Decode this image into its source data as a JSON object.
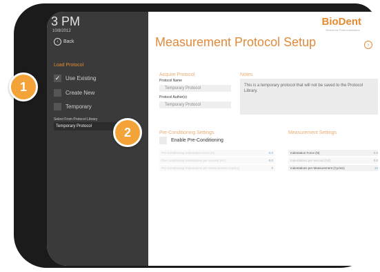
{
  "sidebar": {
    "time": "3 PM",
    "date": "10/8/2012",
    "back_label": "Back",
    "load_heading": "Load Protocol",
    "options": [
      {
        "label": "Use Existing",
        "checked": true
      },
      {
        "label": "Create New",
        "checked": false
      },
      {
        "label": "Temporary",
        "checked": false
      }
    ],
    "library_label": "Select From Protocol Library",
    "library_value": "Temporary Protocol"
  },
  "header": {
    "brand": "BioDent",
    "tagline": "Reference Point Indentation",
    "title": "Measurement Protocol Setup"
  },
  "acquire": {
    "heading": "Acquire Protocol",
    "name_label": "Protocol Name",
    "name_value": "Temporary Protocol",
    "author_label": "Protocol Author(s)",
    "author_value": "Temporary Protocol"
  },
  "notes": {
    "heading": "Notes",
    "text": "This is a temporary protocol that will not be saved to the Protocol Library."
  },
  "precond": {
    "heading": "Pre-Conditioning Settings",
    "enable_label": "Enable Pre-Conditioning",
    "rows": [
      {
        "label": "Pre-Conditioning Indentation Force (N)",
        "value": "0.0"
      },
      {
        "label": "Pre-Conditioning Indentations per Second (Hz)",
        "value": "0.0"
      },
      {
        "label": "Pre-Conditioning Indentations per Measurement (Cycles)",
        "value": "0"
      }
    ]
  },
  "measurement": {
    "heading": "Measurement Settings",
    "rows": [
      {
        "label": "Indentation Force (N)",
        "value": "0.0"
      },
      {
        "label": "Indentations per Second (Hz)",
        "value": "0.0"
      },
      {
        "label": "Indentations per Measurement (Cycles)",
        "value": "10"
      }
    ]
  },
  "callouts": [
    "1",
    "2"
  ],
  "colors": {
    "accent": "#e48a2f",
    "badge": "#f4a338",
    "sidebar": "#3a3a3a"
  }
}
